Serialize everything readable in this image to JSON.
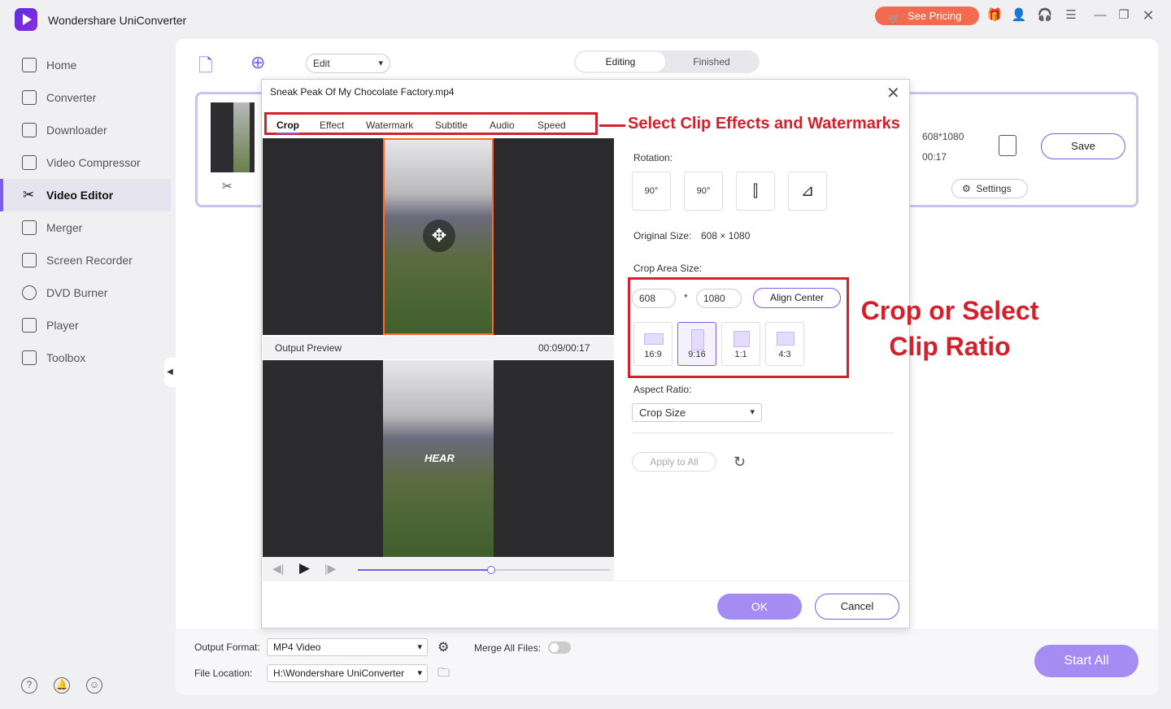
{
  "app": {
    "title": "Wondershare UniConverter",
    "pricing": "See Pricing"
  },
  "sidebar": {
    "items": [
      {
        "label": "Home"
      },
      {
        "label": "Converter"
      },
      {
        "label": "Downloader"
      },
      {
        "label": "Video Compressor"
      },
      {
        "label": "Video Editor"
      },
      {
        "label": "Merger"
      },
      {
        "label": "Screen Recorder"
      },
      {
        "label": "DVD Burner"
      },
      {
        "label": "Player"
      },
      {
        "label": "Toolbox"
      }
    ],
    "active": "Video Editor"
  },
  "toolbar": {
    "edit_select": "Edit",
    "tab_editing": "Editing",
    "tab_finished": "Finished"
  },
  "file": {
    "resolution": "608*1080",
    "duration": "00:17",
    "save": "Save",
    "settings": "Settings"
  },
  "dialog": {
    "title": "Sneak Peak Of My Chocolate Factory.mp4",
    "tabs": [
      "Crop",
      "Effect",
      "Watermark",
      "Subtitle",
      "Audio",
      "Speed"
    ],
    "active_tab": "Crop",
    "output_preview": "Output Preview",
    "time": "00:09/00:17",
    "watermark_text": "HEAR",
    "playback_progress": 0.53,
    "rotation_label": "Rotation:",
    "rotation_buttons": [
      "90°",
      "90°"
    ],
    "original_size_label": "Original Size:",
    "original_size": "608 × 1080",
    "crop_area_label": "Crop Area Size:",
    "crop_width": "608",
    "crop_sep": "*",
    "crop_height": "1080",
    "align_center": "Align Center",
    "ratios": [
      "16:9",
      "9:16",
      "1:1",
      "4:3"
    ],
    "active_ratio": "9:16",
    "aspect_label": "Aspect Ratio:",
    "aspect_value": "Crop Size",
    "apply_all": "Apply to All",
    "ok": "OK",
    "cancel": "Cancel"
  },
  "annotations": {
    "tabs_callout": "Select Clip Effects and Watermarks",
    "ratio_callout_1": "Crop or Select",
    "ratio_callout_2": "Clip Ratio"
  },
  "footer": {
    "output_format_label": "Output Format:",
    "output_format": "MP4 Video",
    "merge_label": "Merge All Files:",
    "file_location_label": "File Location:",
    "file_location": "H:\\Wondershare UniConverter",
    "start_all": "Start All"
  },
  "colors": {
    "accent": "#7a5af0",
    "annotation": "#d3202a",
    "pricing": "#f26a4f"
  }
}
